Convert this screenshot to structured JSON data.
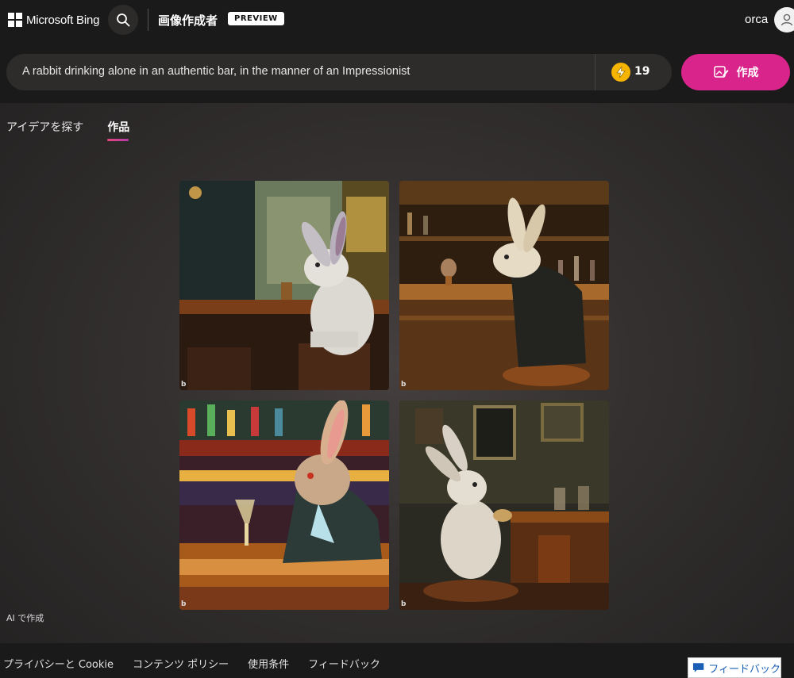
{
  "header": {
    "brand": "Microsoft Bing",
    "title": "画像作成者",
    "badge": "PREVIEW",
    "user": "orca"
  },
  "prompt": {
    "text": "A rabbit drinking alone in an authentic bar, in the manner of an Impressionist",
    "boosts": "19",
    "create_label": "作成"
  },
  "tabs": [
    {
      "label": "アイデアを探す",
      "active": false
    },
    {
      "label": "作品",
      "active": true
    }
  ],
  "images": [
    {
      "mark": "b"
    },
    {
      "mark": "b"
    },
    {
      "mark": "b"
    },
    {
      "mark": "b"
    }
  ],
  "ai_note": "AI で作成",
  "footer": {
    "links": [
      "プライバシーと Cookie",
      "コンテンツ ポリシー",
      "使用条件",
      "フィードバック"
    ],
    "feedback_button": "フィードバック"
  },
  "colors": {
    "accent": "#d9248b",
    "boost": "#f5b400",
    "background": "#1b1a1a"
  }
}
